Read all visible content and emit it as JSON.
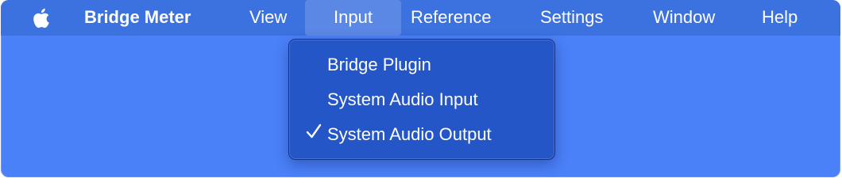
{
  "menubar": {
    "apple_icon": "apple-logo-icon",
    "app_name": "Bridge Meter",
    "items": [
      {
        "label": "View"
      },
      {
        "label": "Input"
      },
      {
        "label": "Reference"
      },
      {
        "label": "Settings"
      },
      {
        "label": "Window"
      },
      {
        "label": "Help"
      }
    ],
    "active_item": "Input"
  },
  "input_menu": {
    "items": [
      {
        "label": "Bridge Plugin",
        "checked": false
      },
      {
        "label": "System Audio Input",
        "checked": false
      },
      {
        "label": "System Audio Output",
        "checked": true
      }
    ]
  },
  "colors": {
    "background": "#4a80f8",
    "menubar": "#3c71e0",
    "dropdown": "#2456c8",
    "text": "#ffffff"
  }
}
